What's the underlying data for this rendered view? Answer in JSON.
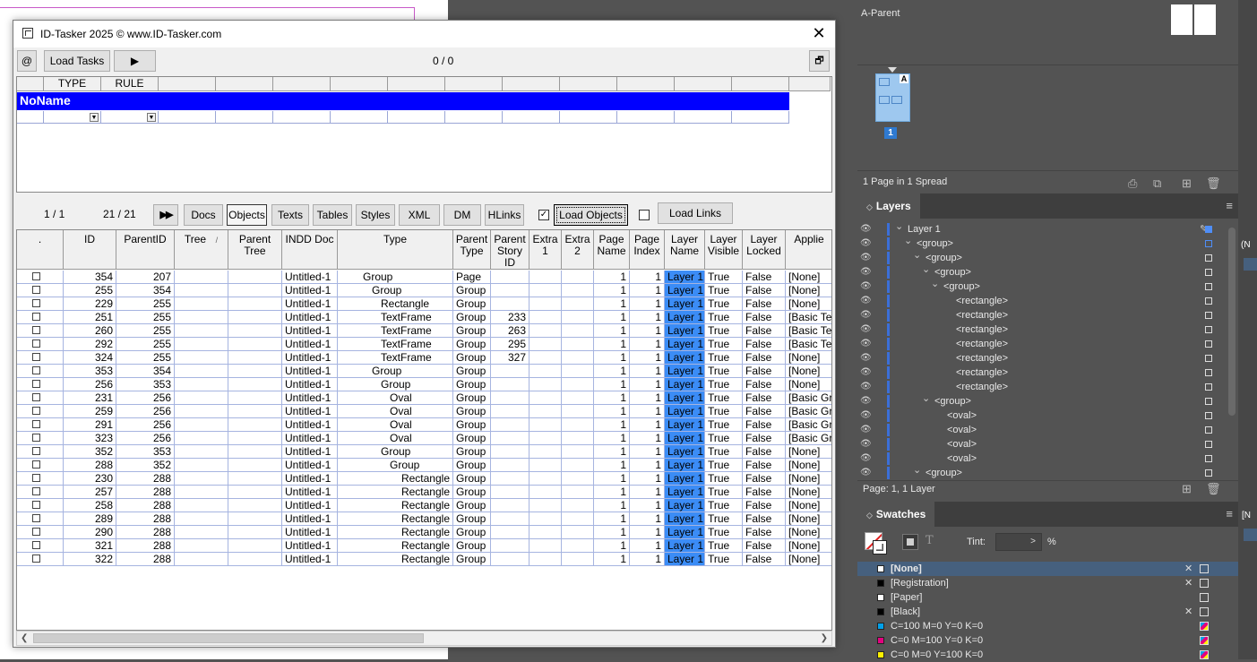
{
  "window": {
    "title": "ID-Tasker 2025  © www.ID-Tasker.com",
    "close_label": "✕"
  },
  "toolbar1": {
    "at_label": "@",
    "load_tasks_label": "Load Tasks",
    "play_label": "▶",
    "counter": "0 / 0",
    "restore_label": "🗗"
  },
  "tasks_grid": {
    "columns": [
      "TYPE",
      "RULE"
    ],
    "group_name": "NoName"
  },
  "toolbar2": {
    "page_counter": "1 / 1",
    "row_counter": "21 / 21",
    "ff_label": "▶▶",
    "tabs": [
      "Docs",
      "Objects",
      "Texts",
      "Tables",
      "Styles",
      "XML",
      "DM",
      "HLinks"
    ],
    "load_objects_label": "Load Objects",
    "load_objects_checked": "✓",
    "load_links_label": "Load Links"
  },
  "objects_table": {
    "headers": [
      ".",
      "ID",
      "ParentID",
      "Tree",
      "Parent\nTree",
      "INDD Doc",
      "Type",
      "Parent\nType",
      "Parent\nStory\nID",
      "Extra\n1",
      "Extra\n2",
      "Page\nName",
      "Page\nIndex",
      "Layer\nName",
      "Layer\nVisible",
      "Layer\nLocked",
      "Applie"
    ],
    "tree_sort_mark": "/",
    "rows": [
      {
        "id": "354",
        "parent": "207",
        "doc": "Untitled-1",
        "type": "Group",
        "ptype": "Page",
        "story": "",
        "pname": "1",
        "pindex": "1",
        "layer": "Layer 1",
        "visible": "True",
        "locked": "False",
        "applied": "[None]"
      },
      {
        "id": "255",
        "parent": "354",
        "doc": "Untitled-1",
        "type": "Group",
        "ptype": "Group",
        "story": "",
        "pname": "1",
        "pindex": "1",
        "layer": "Layer 1",
        "visible": "True",
        "locked": "False",
        "applied": "[None]"
      },
      {
        "id": "229",
        "parent": "255",
        "doc": "Untitled-1",
        "type": "Rectangle",
        "ptype": "Group",
        "story": "",
        "pname": "1",
        "pindex": "1",
        "layer": "Layer 1",
        "visible": "True",
        "locked": "False",
        "applied": "[None]"
      },
      {
        "id": "251",
        "parent": "255",
        "doc": "Untitled-1",
        "type": "TextFrame",
        "ptype": "Group",
        "story": "233",
        "pname": "1",
        "pindex": "1",
        "layer": "Layer 1",
        "visible": "True",
        "locked": "False",
        "applied": "[Basic Te"
      },
      {
        "id": "260",
        "parent": "255",
        "doc": "Untitled-1",
        "type": "TextFrame",
        "ptype": "Group",
        "story": "263",
        "pname": "1",
        "pindex": "1",
        "layer": "Layer 1",
        "visible": "True",
        "locked": "False",
        "applied": "[Basic Te"
      },
      {
        "id": "292",
        "parent": "255",
        "doc": "Untitled-1",
        "type": "TextFrame",
        "ptype": "Group",
        "story": "295",
        "pname": "1",
        "pindex": "1",
        "layer": "Layer 1",
        "visible": "True",
        "locked": "False",
        "applied": "[Basic Te"
      },
      {
        "id": "324",
        "parent": "255",
        "doc": "Untitled-1",
        "type": "TextFrame",
        "ptype": "Group",
        "story": "327",
        "pname": "1",
        "pindex": "1",
        "layer": "Layer 1",
        "visible": "True",
        "locked": "False",
        "applied": "[None]"
      },
      {
        "id": "353",
        "parent": "354",
        "doc": "Untitled-1",
        "type": "Group",
        "ptype": "Group",
        "story": "",
        "pname": "1",
        "pindex": "1",
        "layer": "Layer 1",
        "visible": "True",
        "locked": "False",
        "applied": "[None]"
      },
      {
        "id": "256",
        "parent": "353",
        "doc": "Untitled-1",
        "type": "Group",
        "ptype": "Group",
        "story": "",
        "pname": "1",
        "pindex": "1",
        "layer": "Layer 1",
        "visible": "True",
        "locked": "False",
        "applied": "[None]"
      },
      {
        "id": "231",
        "parent": "256",
        "doc": "Untitled-1",
        "type": "Oval",
        "ptype": "Group",
        "story": "",
        "pname": "1",
        "pindex": "1",
        "layer": "Layer 1",
        "visible": "True",
        "locked": "False",
        "applied": "[Basic Gr"
      },
      {
        "id": "259",
        "parent": "256",
        "doc": "Untitled-1",
        "type": "Oval",
        "ptype": "Group",
        "story": "",
        "pname": "1",
        "pindex": "1",
        "layer": "Layer 1",
        "visible": "True",
        "locked": "False",
        "applied": "[Basic Gr"
      },
      {
        "id": "291",
        "parent": "256",
        "doc": "Untitled-1",
        "type": "Oval",
        "ptype": "Group",
        "story": "",
        "pname": "1",
        "pindex": "1",
        "layer": "Layer 1",
        "visible": "True",
        "locked": "False",
        "applied": "[Basic Gr"
      },
      {
        "id": "323",
        "parent": "256",
        "doc": "Untitled-1",
        "type": "Oval",
        "ptype": "Group",
        "story": "",
        "pname": "1",
        "pindex": "1",
        "layer": "Layer 1",
        "visible": "True",
        "locked": "False",
        "applied": "[Basic Gr"
      },
      {
        "id": "352",
        "parent": "353",
        "doc": "Untitled-1",
        "type": "Group",
        "ptype": "Group",
        "story": "",
        "pname": "1",
        "pindex": "1",
        "layer": "Layer 1",
        "visible": "True",
        "locked": "False",
        "applied": "[None]"
      },
      {
        "id": "288",
        "parent": "352",
        "doc": "Untitled-1",
        "type": "Group",
        "ptype": "Group",
        "story": "",
        "pname": "1",
        "pindex": "1",
        "layer": "Layer 1",
        "visible": "True",
        "locked": "False",
        "applied": "[None]"
      },
      {
        "id": "230",
        "parent": "288",
        "doc": "Untitled-1",
        "type": "Rectangle",
        "ptype": "Group",
        "story": "",
        "pname": "1",
        "pindex": "1",
        "layer": "Layer 1",
        "visible": "True",
        "locked": "False",
        "applied": "[None]"
      },
      {
        "id": "257",
        "parent": "288",
        "doc": "Untitled-1",
        "type": "Rectangle",
        "ptype": "Group",
        "story": "",
        "pname": "1",
        "pindex": "1",
        "layer": "Layer 1",
        "visible": "True",
        "locked": "False",
        "applied": "[None]"
      },
      {
        "id": "258",
        "parent": "288",
        "doc": "Untitled-1",
        "type": "Rectangle",
        "ptype": "Group",
        "story": "",
        "pname": "1",
        "pindex": "1",
        "layer": "Layer 1",
        "visible": "True",
        "locked": "False",
        "applied": "[None]"
      },
      {
        "id": "289",
        "parent": "288",
        "doc": "Untitled-1",
        "type": "Rectangle",
        "ptype": "Group",
        "story": "",
        "pname": "1",
        "pindex": "1",
        "layer": "Layer 1",
        "visible": "True",
        "locked": "False",
        "applied": "[None]"
      },
      {
        "id": "290",
        "parent": "288",
        "doc": "Untitled-1",
        "type": "Rectangle",
        "ptype": "Group",
        "story": "",
        "pname": "1",
        "pindex": "1",
        "layer": "Layer 1",
        "visible": "True",
        "locked": "False",
        "applied": "[None]"
      },
      {
        "id": "321",
        "parent": "288",
        "doc": "Untitled-1",
        "type": "Rectangle",
        "ptype": "Group",
        "story": "",
        "pname": "1",
        "pindex": "1",
        "layer": "Layer 1",
        "visible": "True",
        "locked": "False",
        "applied": "[None]"
      },
      {
        "id": "322",
        "parent": "288",
        "doc": "Untitled-1",
        "type": "Rectangle",
        "ptype": "Group",
        "story": "",
        "pname": "1",
        "pindex": "1",
        "layer": "Layer 1",
        "visible": "True",
        "locked": "False",
        "applied": "[None]"
      }
    ]
  },
  "pages_panel": {
    "parent_label": "A-Parent",
    "page_master_letter": "A",
    "page_number": "1",
    "footer": "1 Page in 1 Spread"
  },
  "layers_panel": {
    "title": "Layers",
    "items": [
      {
        "name": "Layer 1",
        "depth": 0
      },
      {
        "name": "<group>",
        "depth": 1
      },
      {
        "name": "<group>",
        "depth": 2
      },
      {
        "name": "<group>",
        "depth": 3
      },
      {
        "name": "<group>",
        "depth": 4
      },
      {
        "name": "<rectangle>",
        "depth": 5
      },
      {
        "name": "<rectangle>",
        "depth": 5
      },
      {
        "name": "<rectangle>",
        "depth": 5
      },
      {
        "name": "<rectangle>",
        "depth": 5
      },
      {
        "name": "<rectangle>",
        "depth": 5
      },
      {
        "name": "<rectangle>",
        "depth": 5
      },
      {
        "name": "<rectangle>",
        "depth": 5
      },
      {
        "name": "<group>",
        "depth": 3
      },
      {
        "name": "<oval>",
        "depth": 4
      },
      {
        "name": "<oval>",
        "depth": 4
      },
      {
        "name": "<oval>",
        "depth": 4
      },
      {
        "name": "<oval>",
        "depth": 4
      },
      {
        "name": "<group>",
        "depth": 2
      }
    ],
    "footer": "Page: 1, 1 Layer"
  },
  "swatches_panel": {
    "title": "Swatches",
    "tint_label": "Tint:",
    "tint_value": ">",
    "tint_unit": "%",
    "items": [
      {
        "name": "[None]",
        "color": "#ffffff"
      },
      {
        "name": "[Registration]",
        "color": "#000000"
      },
      {
        "name": "[Paper]",
        "color": "#ffffff"
      },
      {
        "name": "[Black]",
        "color": "#000000"
      },
      {
        "name": "C=100 M=0 Y=0 K=0",
        "color": "#00a0e9"
      },
      {
        "name": "C=0 M=100 Y=0 K=0",
        "color": "#e4007f"
      },
      {
        "name": "C=0 M=0 Y=100 K=0",
        "color": "#fff100"
      }
    ]
  },
  "edge": {
    "label1": "(N",
    "label2": "[N"
  },
  "colors": {
    "group_bar": "#0000ff",
    "layer_highlight": "#3b8cf6",
    "panel_bg": "#535353",
    "swatch_selected": "#46607e"
  }
}
